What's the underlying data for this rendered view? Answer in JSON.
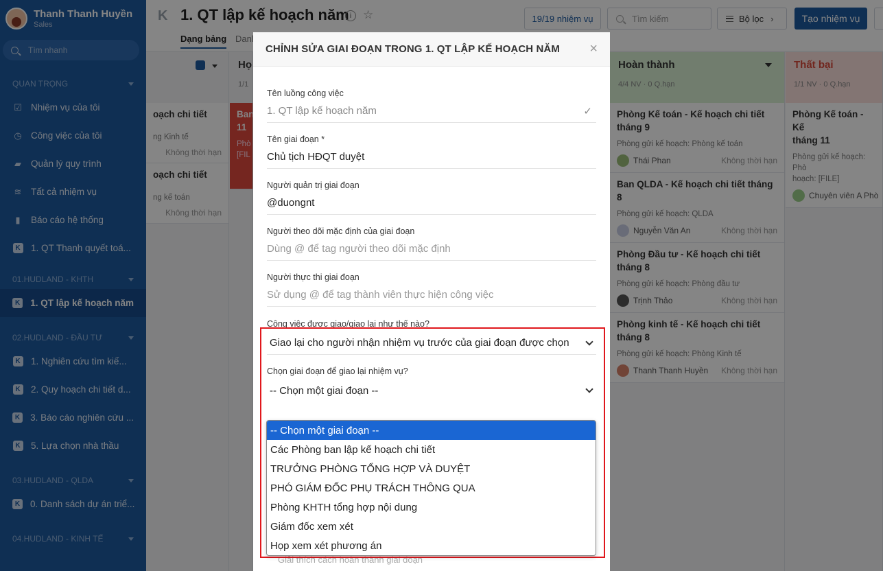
{
  "sidebar": {
    "user_name": "Thanh Thanh Huyền",
    "user_role": "Sales",
    "search_placeholder": "Tìm nhanh",
    "sections": [
      {
        "title": "QUAN TRỌNG",
        "items": [
          {
            "label": "Nhiệm vụ của tôi",
            "icon": "check-square-icon"
          },
          {
            "label": "Công việc của tôi",
            "icon": "clock-icon"
          },
          {
            "label": "Quản lý quy trình",
            "icon": "folder-icon"
          },
          {
            "label": "Tất cả nhiệm vụ",
            "icon": "layers-icon"
          },
          {
            "label": "Báo cáo hệ thống",
            "icon": "bar-chart-icon"
          },
          {
            "label": "1. QT Thanh quyết toá...",
            "icon": "workflow-icon"
          }
        ]
      },
      {
        "title": "01.HUDLAND - KHTH",
        "items": [
          {
            "label": "1. QT lập kế hoạch năm",
            "icon": "workflow-icon",
            "active": true
          }
        ]
      },
      {
        "title": "02.HUDLAND - ĐẦU TƯ",
        "items": [
          {
            "label": "1. Nghiên cứu tìm kiế...",
            "icon": "workflow-icon"
          },
          {
            "label": "2. Quy hoạch chi tiết d...",
            "icon": "workflow-icon"
          },
          {
            "label": "3. Báo cáo nghiên cứu ...",
            "icon": "workflow-icon"
          },
          {
            "label": "5. Lựa chọn nhà thầu",
            "icon": "workflow-icon"
          }
        ]
      },
      {
        "title": "03.HUDLAND - QLDA",
        "items": [
          {
            "label": "0. Danh sách dự án triể...",
            "icon": "workflow-icon"
          }
        ]
      },
      {
        "title": "04.HUDLAND - KINH TẾ",
        "items": []
      }
    ]
  },
  "header": {
    "title": "1. QT lập kế hoạch năm",
    "tabs": [
      "Dạng bảng",
      "Danh"
    ],
    "task_count": "19/19 nhiệm vụ",
    "search_placeholder": "Tìm kiếm",
    "filter_label": "Bộ lọc",
    "create_label": "Tạo nhiệm vụ"
  },
  "board": {
    "col1": {
      "cards": [
        {
          "title": "oạch chi tiết",
          "desc": "ng Kinh tế",
          "deadline": "Không thời hạn"
        },
        {
          "title": "oạch chi tiết",
          "desc": "ng kế toán",
          "deadline": "Không thời hạn"
        }
      ]
    },
    "col2": {
      "title": "Họ",
      "sub": "1/1",
      "card": {
        "title": "Ban\n11",
        "desc": "Phò\n[FIL"
      }
    },
    "done": {
      "title": "Hoàn thành",
      "sub": "4/4 NV · 0 Q.hạn",
      "color": "#2e7d32",
      "cards": [
        {
          "title": "Phòng Kế toán - Kế hoạch chi tiết tháng 9",
          "desc": "Phòng gửi kế hoạch: Phòng kế toán",
          "person": "Thái Phan",
          "deadline": "Không thời hạn"
        },
        {
          "title": "Ban QLDA - Kế hoạch chi tiết tháng 8",
          "desc": "Phòng gửi kế hoạch: QLDA",
          "person": "Nguyễn Văn An",
          "deadline": "Không thời hạn"
        },
        {
          "title": "Phòng Đầu tư - Kế hoạch chi tiết tháng 8",
          "desc": "Phòng gửi kế hoạch: Phòng đầu tư",
          "person": "Trịnh Thảo",
          "deadline": "Không thời hạn"
        },
        {
          "title": "Phòng kinh tế - Kế hoạch chi tiết tháng 8",
          "desc": "Phòng gửi kế hoạch: Phòng Kinh tế",
          "person": "Thanh Thanh Huyền",
          "deadline": "Không thời hạn"
        }
      ]
    },
    "fail": {
      "title": "Thất bại",
      "sub": "1/1 NV · 0 Q.hạn",
      "color": "#d84a3a",
      "card": {
        "title": "Phòng Kế toán - Kế\ntháng 11",
        "desc": "Phòng gửi kế hoạch: Phò\nhoạch: [FILE]",
        "person": "Chuyên viên A Phò"
      }
    }
  },
  "modal": {
    "title": "CHỈNH SỬA GIAI ĐOẠN TRONG 1. QT LẬP KẾ HOẠCH NĂM",
    "workflow_name_label": "Tên luồng công việc",
    "workflow_name_value": "1. QT lập kế hoạch năm",
    "stage_name_label": "Tên giai đoạn *",
    "stage_name_value": "Chủ tịch HĐQT duyệt",
    "admin_label": "Người quản trị giai đoạn",
    "admin_value": "@duongnt",
    "followers_label": "Người theo dõi mặc định của giai đoạn",
    "followers_placeholder": "Dùng @ để tag người theo dõi mặc định",
    "executors_label": "Người thực thi giai đoạn",
    "executors_placeholder": "Sử dụng @ để tag thành viên thực hiện công việc",
    "assign_label": "Công việc được giao/giao lại như thế nào?",
    "assign_value": "Giao lại cho người nhận nhiệm vụ trước của giai đoạn được chọn",
    "choose_stage_label": "Chọn giai đoạn để giao lại nhiệm vụ?",
    "choose_stage_value": "-- Chọn một giai đoạn --",
    "options": [
      "-- Chọn một giai đoạn --",
      "Các Phòng ban lập kế hoạch chi tiết",
      "TRƯỞNG PHÒNG TỔNG HỢP VÀ DUYỆT",
      "PHÓ GIÁM ĐỐC PHỤ TRÁCH THÔNG QUA",
      "Phòng KHTH tổng hợp nội dung",
      "Giám đốc xem xét",
      "Họp xem xét phương án"
    ],
    "hint_placeholder": "Giải thích cách hoàn thành giai đoạn"
  },
  "colors": {
    "brand": "#1e5aa0",
    "selected_option": "#1a66d3",
    "highlight": "#e0171c"
  }
}
